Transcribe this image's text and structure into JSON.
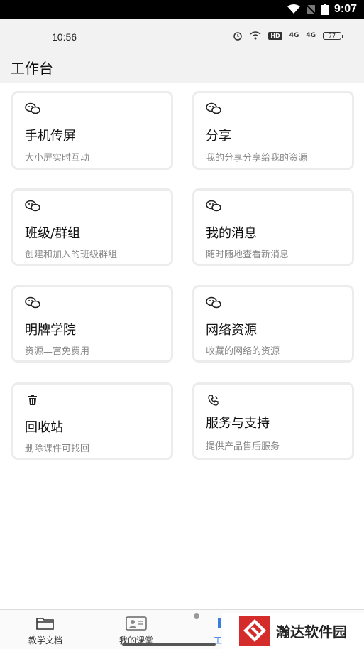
{
  "system_bar": {
    "time": "9:07"
  },
  "app_status": {
    "time": "10:56",
    "hd": "HD",
    "net1": "4G",
    "net2": "4G",
    "battery": "77"
  },
  "header": {
    "title": "工作台"
  },
  "cards": [
    {
      "title": "手机传屏",
      "subtitle": "大小屏实时互动",
      "icon": "wechat-icon"
    },
    {
      "title": "分享",
      "subtitle": "我的分享分享给我的资源",
      "icon": "wechat-icon"
    },
    {
      "title": "班级/群组",
      "subtitle": "创建和加入的班级群组",
      "icon": "wechat-icon"
    },
    {
      "title": "我的消息",
      "subtitle": "随时随地查看新消息",
      "icon": "wechat-icon"
    },
    {
      "title": "明牌学院",
      "subtitle": "资源丰富免费用",
      "icon": "wechat-icon"
    },
    {
      "title": "网络资源",
      "subtitle": "收藏的网络的资源",
      "icon": "wechat-icon"
    },
    {
      "title": "回收站",
      "subtitle": "删除课件可找回",
      "icon": "trash-icon"
    },
    {
      "title": "服务与支持",
      "subtitle": "提供产品售后服务",
      "icon": "phone-icon"
    }
  ],
  "bottom_nav": [
    {
      "label": "教学文档",
      "icon": "folder-icon"
    },
    {
      "label": "我的课堂",
      "icon": "id-card-icon"
    },
    {
      "label": "工",
      "icon": "workbench-icon"
    }
  ],
  "watermark": {
    "text": "瀚达软件园"
  }
}
